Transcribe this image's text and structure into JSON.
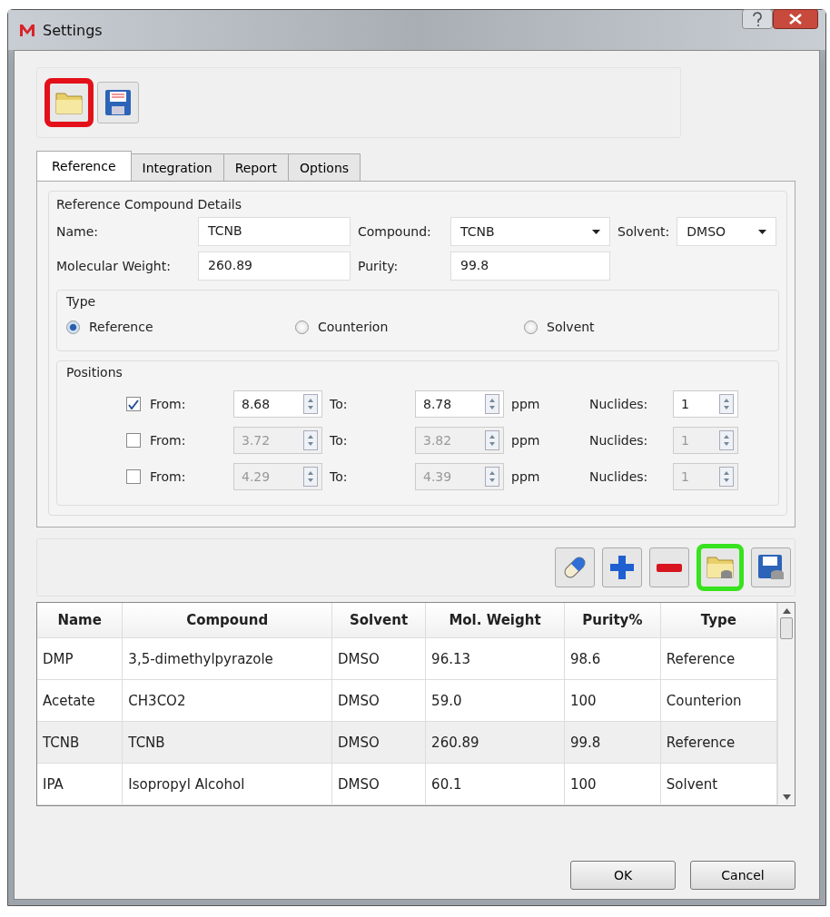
{
  "window": {
    "title": "Settings"
  },
  "top_toolbar": [
    {
      "kind": "open",
      "highlighted": true
    },
    {
      "kind": "save",
      "highlighted": false
    }
  ],
  "tabs": [
    {
      "label": "Reference",
      "selected": true
    },
    {
      "label": "Integration",
      "selected": false
    },
    {
      "label": "Report",
      "selected": false
    },
    {
      "label": "Options",
      "selected": false
    }
  ],
  "details": {
    "title": "Reference Compound Details",
    "name": {
      "label": "Name:",
      "value": "TCNB"
    },
    "compound": {
      "label": "Compound:",
      "value": "TCNB"
    },
    "solvent": {
      "label": "Solvent:",
      "value": "DMSO"
    },
    "molecular_weight": {
      "label": "Molecular Weight:",
      "value": "260.89"
    },
    "purity": {
      "label": "Purity:",
      "value": "99.8"
    }
  },
  "type_group": {
    "title": "Type",
    "options": [
      {
        "label": "Reference",
        "selected": true
      },
      {
        "label": "Counterion",
        "selected": false
      },
      {
        "label": "Solvent",
        "selected": false
      }
    ]
  },
  "positions": {
    "title": "Positions",
    "rows": [
      {
        "checked": true,
        "from_label": "From:",
        "from": "8.68",
        "to_label": "To:",
        "to": "8.78",
        "unit": "ppm",
        "nuclides_label": "Nuclides:",
        "nuclides": "1"
      },
      {
        "checked": false,
        "from_label": "From:",
        "from": "3.72",
        "to_label": "To:",
        "to": "3.82",
        "unit": "ppm",
        "nuclides_label": "Nuclides:",
        "nuclides": "1"
      },
      {
        "checked": false,
        "from_label": "From:",
        "from": "4.29",
        "to_label": "To:",
        "to": "4.39",
        "unit": "ppm",
        "nuclides_label": "Nuclides:",
        "nuclides": "1"
      }
    ]
  },
  "table_toolbar": [
    {
      "kind": "eraser",
      "highlighted": false
    },
    {
      "kind": "add",
      "highlighted": false
    },
    {
      "kind": "remove",
      "highlighted": false
    },
    {
      "kind": "load",
      "highlighted": true
    },
    {
      "kind": "save",
      "highlighted": false
    }
  ],
  "table": {
    "columns": [
      "Name",
      "Compound",
      "Solvent",
      "Mol. Weight",
      "Purity%",
      "Type"
    ],
    "rows": [
      {
        "selected": false,
        "cells": [
          "DMP",
          "3,5-dimethylpyrazole",
          "DMSO",
          "96.13",
          "98.6",
          "Reference"
        ]
      },
      {
        "selected": false,
        "cells": [
          "Acetate",
          "CH3CO2",
          "DMSO",
          "59.0",
          "100",
          "Counterion"
        ]
      },
      {
        "selected": true,
        "cells": [
          "TCNB",
          "TCNB",
          "DMSO",
          "260.89",
          "99.8",
          "Reference"
        ]
      },
      {
        "selected": false,
        "cells": [
          "IPA",
          "Isopropyl Alcohol",
          "DMSO",
          "60.1",
          "100",
          "Solvent"
        ]
      }
    ]
  },
  "buttons": [
    {
      "label": "OK"
    },
    {
      "label": "Cancel"
    }
  ]
}
